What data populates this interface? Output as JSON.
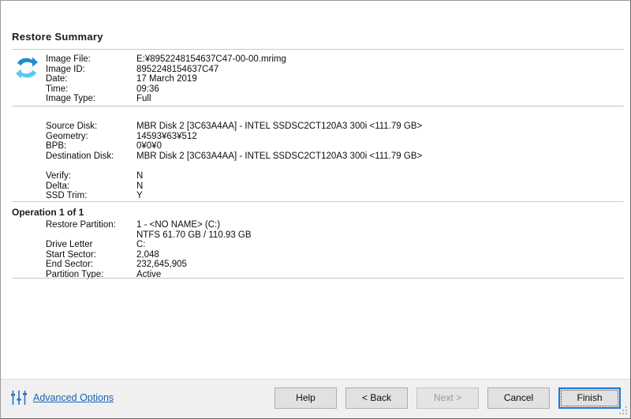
{
  "window": {
    "title": "Restore Summary"
  },
  "icons": {
    "restore": "restore-arrows-icon",
    "advanced": "sliders-icon"
  },
  "summary": {
    "title": "Restore Summary",
    "image_section": [
      {
        "label": "Image File:",
        "value": "E:¥8952248154637C47-00-00.mrimg"
      },
      {
        "label": "Image ID:",
        "value": "8952248154637C47"
      },
      {
        "label": "Date:",
        "value": "17 March 2019"
      },
      {
        "label": "Time:",
        "value": "09:36"
      },
      {
        "label": "Image Type:",
        "value": "Full"
      }
    ],
    "disk_section": [
      {
        "label": "Source Disk:",
        "value": "MBR Disk 2 [3C63A4AA] - INTEL SSDSC2CT120A3 300i  <111.79 GB>"
      },
      {
        "label": "Geometry:",
        "value": "14593¥63¥512"
      },
      {
        "label": "BPB:",
        "value": "0¥0¥0"
      },
      {
        "label": "Destination Disk:",
        "value": "MBR Disk 2 [3C63A4AA] - INTEL SSDSC2CT120A3 300i  <111.79 GB>"
      }
    ],
    "options_section": [
      {
        "label": "Verify:",
        "value": "N"
      },
      {
        "label": "Delta:",
        "value": "N"
      },
      {
        "label": "SSD Trim:",
        "value": "Y"
      }
    ]
  },
  "operation": {
    "heading": "Operation 1 of 1",
    "rows": [
      {
        "label": "Restore Partition:",
        "value": "1 - <NO NAME> (C:)"
      },
      {
        "label": "",
        "value": "NTFS 61.70 GB / 110.93 GB"
      },
      {
        "label": "Drive Letter",
        "value": "C:"
      },
      {
        "label": "Start Sector:",
        "value": "2,048"
      },
      {
        "label": "End Sector:",
        "value": "232,645,905"
      },
      {
        "label": "Partition Type:",
        "value": "Active"
      }
    ]
  },
  "footer": {
    "advanced_options": "Advanced Options",
    "buttons": {
      "help": "Help",
      "back": "< Back",
      "next": "Next >",
      "cancel": "Cancel",
      "finish": "Finish"
    }
  },
  "colors": {
    "link": "#1763b5",
    "accent": "#1a7ad4",
    "icon_blue_dark": "#1b8fd0",
    "icon_blue_light": "#5bc8ef",
    "footer_bg": "#f0f0f0",
    "separator": "#c8c8c8"
  }
}
